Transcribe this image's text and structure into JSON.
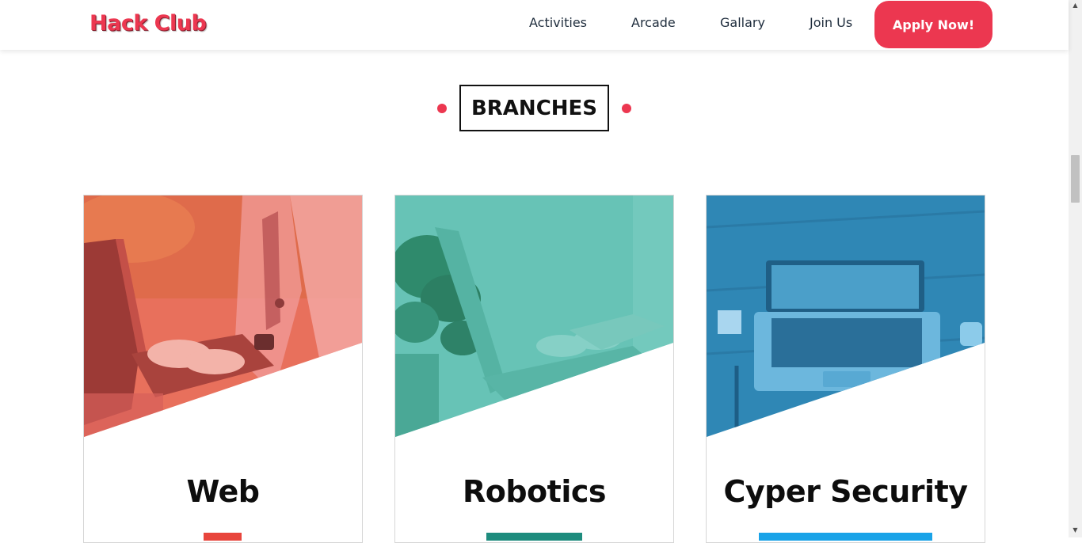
{
  "header": {
    "logo": "Hack Club",
    "nav": [
      {
        "label": "Activities"
      },
      {
        "label": "Arcade"
      },
      {
        "label": "Gallary"
      },
      {
        "label": "Join Us"
      }
    ],
    "apply_label": "Apply Now!"
  },
  "section": {
    "title": "BRANCHES"
  },
  "cards": [
    {
      "title": "Web",
      "overlay_color": "#ec5a4d",
      "bar_color": "#e8453c"
    },
    {
      "title": "Robotics",
      "overlay_color": "#3fbfae",
      "bar_color": "#1e8c7e"
    },
    {
      "title": "Cyper Security",
      "overlay_color": "#2a8ec2",
      "bar_color": "#1aa3e8"
    }
  ],
  "colors": {
    "accent": "#ec3750"
  }
}
